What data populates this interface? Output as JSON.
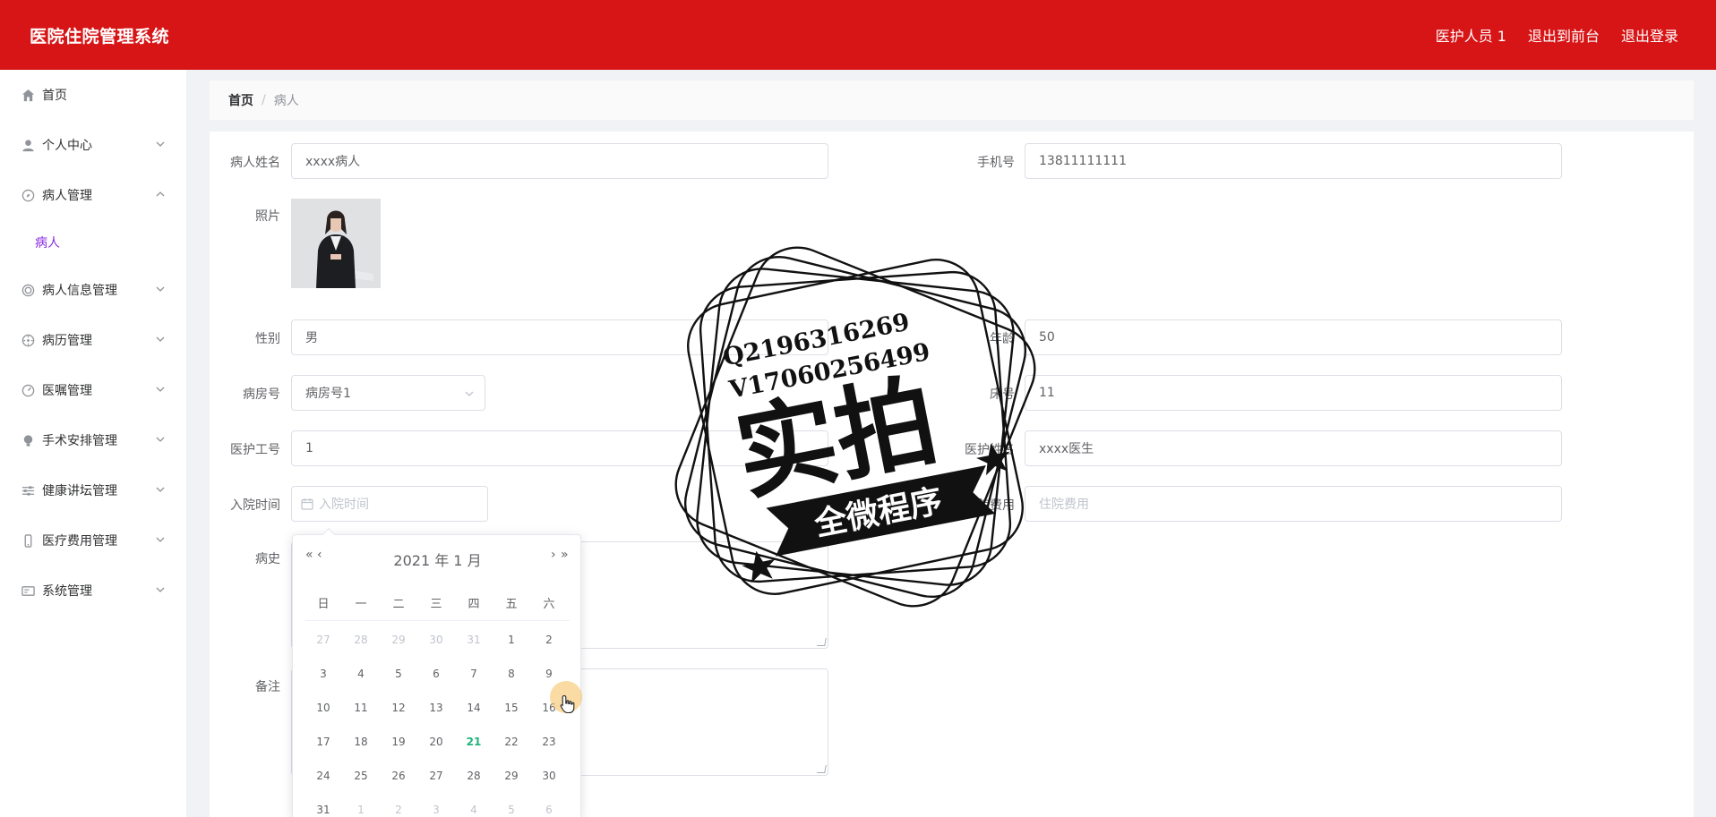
{
  "header": {
    "title": "医院住院管理系统",
    "nav": [
      "医护人员 1",
      "退出到前台",
      "退出登录"
    ]
  },
  "sidebar": {
    "items": [
      {
        "label": "首页",
        "icon": "home-icon"
      },
      {
        "label": "个人中心",
        "icon": "user-icon"
      },
      {
        "label": "病人管理",
        "icon": "compass-icon"
      },
      {
        "label": "病人信息管理",
        "icon": "ring-icon"
      },
      {
        "label": "病历管理",
        "icon": "dial-icon"
      },
      {
        "label": "医嘱管理",
        "icon": "gauge-icon"
      },
      {
        "label": "手术安排管理",
        "icon": "bulb-icon"
      },
      {
        "label": "健康讲坛管理",
        "icon": "sliders-icon"
      },
      {
        "label": "医疗费用管理",
        "icon": "phone-icon"
      },
      {
        "label": "系统管理",
        "icon": "card-icon"
      }
    ],
    "active_sub": "病人"
  },
  "breadcrumb": {
    "home": "首页",
    "sep": "/",
    "current": "病人"
  },
  "form": {
    "name_label": "病人姓名",
    "name_value": "xxxx病人",
    "phone_label": "手机号",
    "phone_value": "13811111111",
    "photo_label": "照片",
    "gender_label": "性别",
    "gender_value": "男",
    "age_label": "年龄",
    "age_value": "50",
    "room_label": "病房号",
    "room_value": "病房号1",
    "bed_label": "床号",
    "bed_value": "11",
    "staff_id_label": "医护工号",
    "staff_id_value": "1",
    "staff_name_label": "医护姓名",
    "staff_name_value": "xxxx医生",
    "admit_label": "入院时间",
    "admit_placeholder": "入院时间",
    "fee_label": "住院费用",
    "fee_placeholder": "住院费用",
    "history_label": "病史",
    "remark_label": "备注"
  },
  "datepicker": {
    "year_month": "2021 年  1 月",
    "prev_year": "«",
    "prev_month": "‹",
    "next_month": "›",
    "next_year": "»",
    "weekdays": [
      "日",
      "一",
      "二",
      "三",
      "四",
      "五",
      "六"
    ],
    "weeks": [
      [
        "27",
        "28",
        "29",
        "30",
        "31",
        "1",
        "2"
      ],
      [
        "3",
        "4",
        "5",
        "6",
        "7",
        "8",
        "9"
      ],
      [
        "10",
        "11",
        "12",
        "13",
        "14",
        "15",
        "16"
      ],
      [
        "17",
        "18",
        "19",
        "20",
        "21",
        "22",
        "23"
      ],
      [
        "24",
        "25",
        "26",
        "27",
        "28",
        "29",
        "30"
      ],
      [
        "31",
        "1",
        "2",
        "3",
        "4",
        "5",
        "6"
      ]
    ],
    "today": "21"
  },
  "watermark": {
    "line1": "Q2196316269",
    "line2": "V17060256499",
    "big": "实拍",
    "banner": "全微程序"
  }
}
